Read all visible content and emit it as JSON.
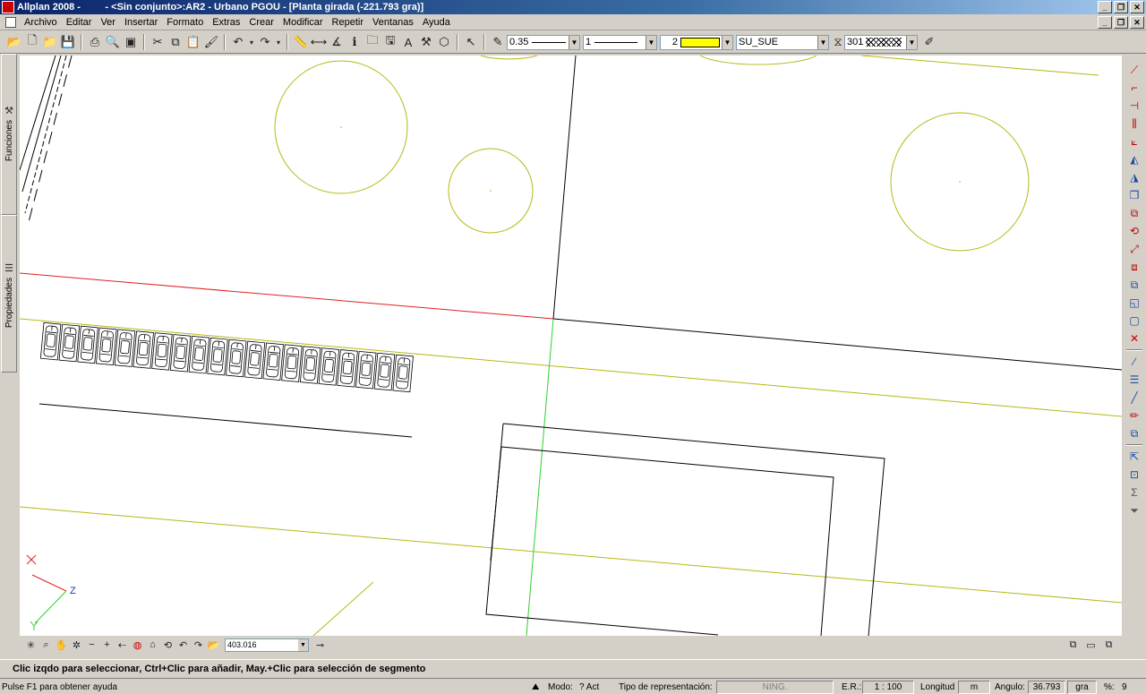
{
  "window": {
    "app_title": "Allplan 2008 -",
    "doc_title": "         - <Sin conjunto>:AR2 - Urbano PGOU - [Planta girada (-221.793 gra)]",
    "buttons": [
      "_",
      "❐",
      "✕"
    ]
  },
  "menubar": {
    "items": [
      "Archivo",
      "Editar",
      "Ver",
      "Insertar",
      "Formato",
      "Extras",
      "Crear",
      "Modificar",
      "Repetir",
      "Ventanas",
      "Ayuda"
    ]
  },
  "toolbar": {
    "pen_thickness": "0.35",
    "line_type": "1",
    "color": "2",
    "color_hex": "#ffff00",
    "layer": "SU_SUE",
    "hatch": "301"
  },
  "side_tabs": {
    "functions": "Funciones",
    "properties": "Propiedades"
  },
  "canvas": {
    "axis_label_z": "Z",
    "colors": {
      "olive_line": "#b5b814",
      "red_axis": "#e02020",
      "green_axis": "#2ed12e",
      "geometry": "#000000"
    },
    "car_count": 20
  },
  "nav_toolbar": {
    "zoom_value": "403.016"
  },
  "prompt": {
    "text": "Clic izqdo para seleccionar, Ctrl+Clic para añadir, May.+Clic para selección de segmento"
  },
  "statusbar": {
    "help": "Pulse F1 para obtener ayuda",
    "mode_label": "Modo:",
    "mode_value": "? Act",
    "repr_label": "Tipo de representación:",
    "repr_value": "NING.",
    "scale_label": "E.R.:",
    "scale_value": "1 : 100",
    "length_label": "Longitud",
    "length_value": "m",
    "angle_label": "Angulo:",
    "angle_value": "36.793",
    "angle_unit": "gra",
    "percent_label": "%:",
    "percent_value": "9"
  }
}
